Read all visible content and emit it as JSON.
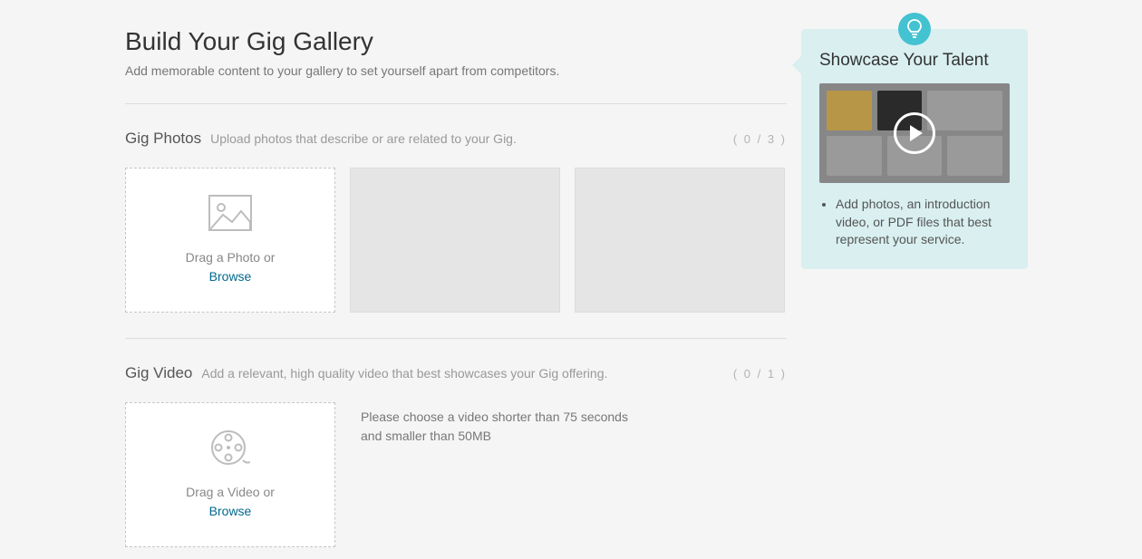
{
  "page": {
    "title": "Build Your Gig Gallery",
    "subtitle": "Add memorable content to your gallery to set yourself apart from competitors."
  },
  "photos": {
    "title": "Gig Photos",
    "desc": "Upload photos that describe or are related to your Gig.",
    "count": "( 0 / 3 )",
    "drag_text": "Drag a Photo or",
    "browse": "Browse"
  },
  "video": {
    "title": "Gig Video",
    "desc": "Add a relevant, high quality video that best showcases your Gig offering.",
    "count": "( 0 / 1 )",
    "drag_text": "Drag a Video or",
    "browse": "Browse",
    "hint": "Please choose a video shorter than 75 seconds and smaller than 50MB"
  },
  "sidebar": {
    "title": "Showcase Your Talent",
    "tip": "Add photos, an introduction video, or PDF files that best represent your service."
  }
}
